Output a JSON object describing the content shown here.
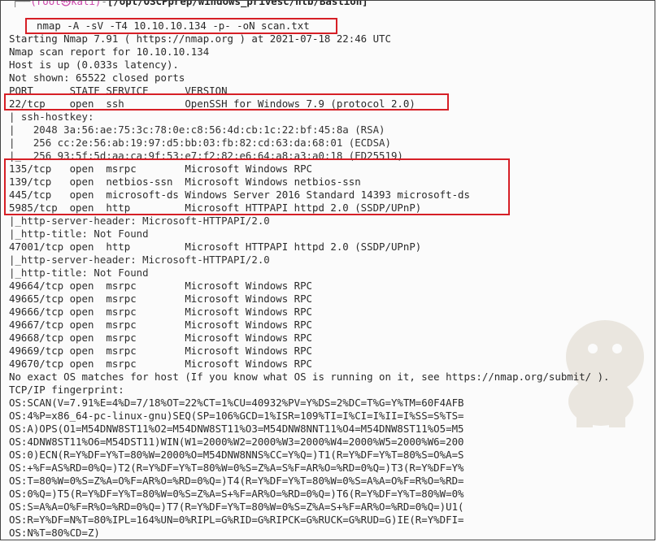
{
  "prompt": {
    "corner": "┌──",
    "user_host": "(root㉿kali)",
    "dash": "-",
    "path": "[/opt/OSCPprep/windows_privesc/htb/Bastion]"
  },
  "command": "nmap -A -sV -T4 10.10.10.134 -p- -oN scan.txt",
  "lines": [
    "Starting Nmap 7.91 ( https://nmap.org ) at 2021-07-18 22:46 UTC",
    "Nmap scan report for 10.10.10.134",
    "Host is up (0.033s latency).",
    "Not shown: 65522 closed ports",
    "PORT      STATE SERVICE      VERSION",
    "22/tcp    open  ssh          OpenSSH for_Windows_7.9 (protocol 2.0)",
    "| ssh-hostkey:",
    "|   2048 3a:56:ae:75:3c:78:0e:c8:56:4d:cb:1c:22:bf:45:8a (RSA)",
    "|   256 cc:2e:56:ab:19:97:d5:bb:03:fb:82:cd:63:da:68:01 (ECDSA)",
    "|_  256 93:5f:5d:aa:ca:9f:53:e7:f2:82:e6:64:a8:a3:a0:18 (ED25519)",
    "135/tcp   open  msrpc        Microsoft Windows RPC",
    "139/tcp   open  netbios-ssn  Microsoft Windows netbios-ssn",
    "445/tcp   open  microsoft-ds Windows Server 2016 Standard 14393 microsoft-ds",
    "5985/tcp  open  http         Microsoft HTTPAPI httpd 2.0 (SSDP/UPnP)",
    "|_http-server-header: Microsoft-HTTPAPI/2.0",
    "|_http-title: Not Found",
    "47001/tcp open  http         Microsoft HTTPAPI httpd 2.0 (SSDP/UPnP)",
    "|_http-server-header: Microsoft-HTTPAPI/2.0",
    "|_http-title: Not Found",
    "49664/tcp open  msrpc        Microsoft Windows RPC",
    "49665/tcp open  msrpc        Microsoft Windows RPC",
    "49666/tcp open  msrpc        Microsoft Windows RPC",
    "49667/tcp open  msrpc        Microsoft Windows RPC",
    "49668/tcp open  msrpc        Microsoft Windows RPC",
    "49669/tcp open  msrpc        Microsoft Windows RPC",
    "49670/tcp open  msrpc        Microsoft Windows RPC",
    "No exact OS matches for host (If you know what OS is running on it, see https://nmap.org/submit/ ).",
    "TCP/IP fingerprint:",
    "OS:SCAN(V=7.91%E=4%D=7/18%OT=22%CT=1%CU=40932%PV=Y%DS=2%DC=T%G=Y%TM=60F4AFB",
    "OS:4%P=x86_64-pc-linux-gnu)SEQ(SP=106%GCD=1%ISR=109%TI=I%CI=I%II=I%SS=S%TS=",
    "OS:A)OPS(O1=M54DNW8ST11%O2=M54DNW8ST11%O3=M54DNW8NNT11%O4=M54DNW8ST11%O5=M5",
    "OS:4DNW8ST11%O6=M54DST11)WIN(W1=2000%W2=2000%W3=2000%W4=2000%W5=2000%W6=200",
    "OS:0)ECN(R=Y%DF=Y%T=80%W=2000%O=M54DNW8NNS%CC=Y%Q=)T1(R=Y%DF=Y%T=80%S=O%A=S",
    "OS:+%F=AS%RD=0%Q=)T2(R=Y%DF=Y%T=80%W=0%S=Z%A=S%F=AR%O=%RD=0%Q=)T3(R=Y%DF=Y%",
    "OS:T=80%W=0%S=Z%A=O%F=AR%O=%RD=0%Q=)T4(R=Y%DF=Y%T=80%W=0%S=A%A=O%F=R%O=%RD=",
    "OS:0%Q=)T5(R=Y%DF=Y%T=80%W=0%S=Z%A=S+%F=AR%O=%RD=0%Q=)T6(R=Y%DF=Y%T=80%W=0%",
    "OS:S=A%A=O%F=R%O=%RD=0%Q=)T7(R=Y%DF=Y%T=80%W=0%S=Z%A=S+%F=AR%O=%RD=0%Q=)U1(",
    "OS:R=Y%DF=N%T=80%IPL=164%UN=0%RIPL=G%RID=G%RIPCK=G%RUCK=G%RUD=G)IE(R=Y%DFI=",
    "OS:N%T=80%CD=Z)"
  ]
}
